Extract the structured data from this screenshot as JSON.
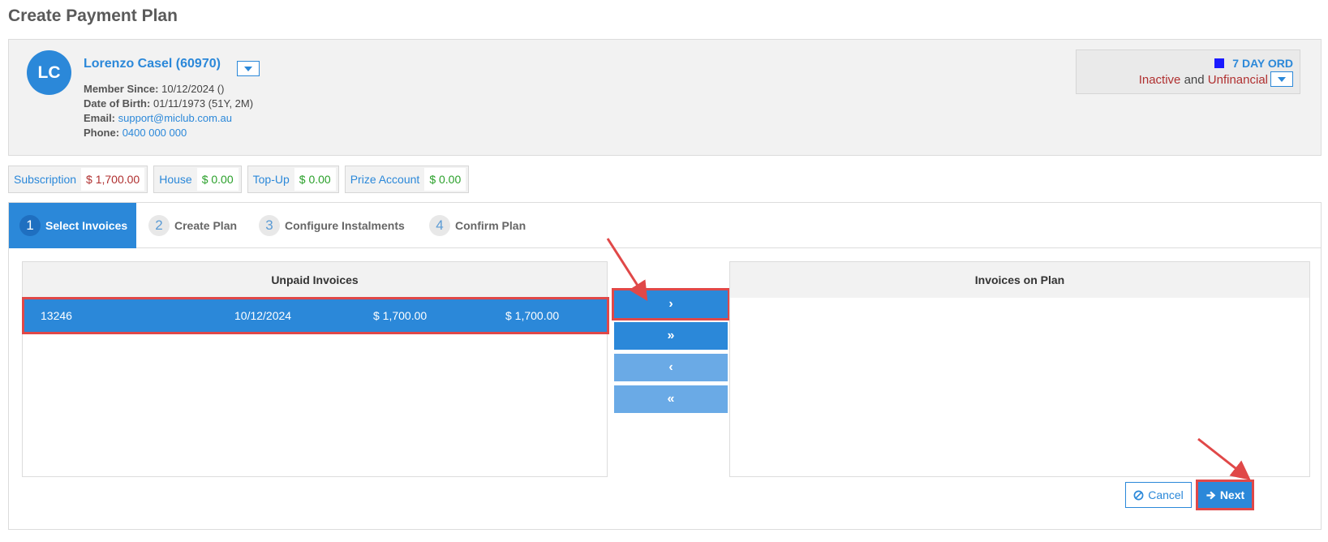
{
  "page": {
    "title": "Create Payment Plan"
  },
  "member": {
    "initials": "LC",
    "name": "Lorenzo Casel (60970)",
    "member_since_label": "Member Since:",
    "member_since": "10/12/2024 ()",
    "dob_label": "Date of Birth:",
    "dob": "01/11/1973 (51Y, 2M)",
    "email_label": "Email:",
    "email": "support@miclub.com.au",
    "phone_label": "Phone:",
    "phone": "0400 000 000"
  },
  "status": {
    "membership_type": "7 DAY ORD",
    "membership_color": "#1a1aff",
    "state1": "Inactive",
    "joiner": "and",
    "state2": "Unfinancial"
  },
  "accounts": [
    {
      "name": "Subscription",
      "value": "$ 1,700.00",
      "tone": "negative"
    },
    {
      "name": "House",
      "value": "$ 0.00",
      "tone": "positive"
    },
    {
      "name": "Top-Up",
      "value": "$ 0.00",
      "tone": "positive"
    },
    {
      "name": "Prize Account",
      "value": "$ 0.00",
      "tone": "positive"
    }
  ],
  "wizard": {
    "steps": [
      {
        "num": "1",
        "label": "Select Invoices",
        "active": true
      },
      {
        "num": "2",
        "label": "Create Plan",
        "active": false
      },
      {
        "num": "3",
        "label": "Configure Instalments",
        "active": false
      },
      {
        "num": "4",
        "label": "Confirm Plan",
        "active": false
      }
    ],
    "unpaid_header": "Unpaid Invoices",
    "onplan_header": "Invoices on Plan",
    "unpaid_rows": [
      {
        "number": "13246",
        "date": "10/12/2024",
        "amount": "$ 1,700.00",
        "outstanding": "$ 1,700.00"
      }
    ],
    "transfer_buttons": {
      "move_selected": "›",
      "move_all": "»",
      "remove_selected": "‹",
      "remove_all": "«"
    },
    "cancel_label": "Cancel",
    "next_label": "Next"
  },
  "colors": {
    "accent": "#2b88d9",
    "highlight": "#e04848",
    "negative": "#b03030",
    "positive": "#2aa02a"
  }
}
